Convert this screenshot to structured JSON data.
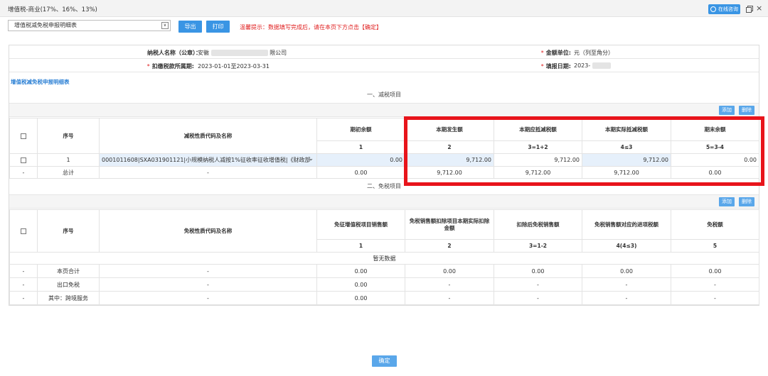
{
  "window": {
    "title": "增值税-商业(17%、16%、13%)",
    "online_consult": "在线咨询",
    "close_glyph": "×"
  },
  "toolbar": {
    "report_select": "增值税减免税申报明细表",
    "select_arrow": "∨",
    "export_label": "导出",
    "print_label": "打印",
    "tip": "温馨提示：数据填写完成后，请在本页下方点击【确定】"
  },
  "info": {
    "taxpayer_label": "纳税人名称（公章）：",
    "taxpayer_prefix": "安徽",
    "taxpayer_suffix": "限公司",
    "amount_unit_label": "金额单位:",
    "amount_unit_value": "元（列至角分）",
    "period_label": "扣缴税款所属期:",
    "period_value": "2023-01-01至2023-03-31",
    "fill_date_label": "填报日期:",
    "fill_date_value": "2023-",
    "star": "*"
  },
  "form_title": "增值税减免税申报明细表",
  "reduction": {
    "title": "一、减税项目",
    "add_label": "添加",
    "delete_label": "删除",
    "headers": {
      "seq": "序号",
      "name": "减税性质代码及名称",
      "c1": "期初余额",
      "c2": "本期发生额",
      "c3": "本期应抵减税额",
      "c4": "本期实际抵减税额",
      "c5": "期末余额"
    },
    "col_nums": [
      "1",
      "2",
      "3=1+2",
      "4≤3",
      "5=3-4"
    ],
    "row1": {
      "seq": "1",
      "name": "0001011608|SXA031901121|小规模纳税人减按1%征收率征收增值税|《财政部",
      "c1": "0.00",
      "c2": "9,712.00",
      "c3": "9,712.00",
      "c4": "9,712.00",
      "c5": "0.00"
    },
    "total": {
      "dash": "-",
      "label": "总计",
      "name": "-",
      "c1": "0.00",
      "c2": "9,712.00",
      "c3": "9,712.00",
      "c4": "9,712.00",
      "c5": "0.00"
    }
  },
  "exemption": {
    "title": "二、免税项目",
    "add_label": "添加",
    "delete_label": "删除",
    "headers": {
      "seq": "序号",
      "name": "免税性质代码及名称",
      "c1": "免征增值税项目销售额",
      "c2": "免税销售额扣除项目本期实际扣除金额",
      "c3": "扣除后免税销售额",
      "c4": "免税销售额对应的进项税额",
      "c5": "免税额"
    },
    "col_nums": [
      "1",
      "2",
      "3=1-2",
      "4(4≤3)",
      "5"
    ],
    "empty": "暂无数据",
    "rows": [
      {
        "dash": "-",
        "label": "本页合计",
        "name": "-",
        "c1": "0.00",
        "c2": "0.00",
        "c3": "0.00",
        "c4": "0.00",
        "c5": "0.00"
      },
      {
        "dash": "-",
        "label": "出口免税",
        "name": "-",
        "c1": "0.00",
        "c2": "-",
        "c3": "-",
        "c4": "-",
        "c5": "-"
      },
      {
        "dash": "-",
        "label": "其中：跨境服务",
        "name": "-",
        "c1": "0.00",
        "c2": "-",
        "c3": "-",
        "c4": "-",
        "c5": "-"
      }
    ]
  },
  "confirm_label": "确定",
  "colors": {
    "accent": "#3a95e4",
    "highlight_border": "#e8141b",
    "tip_text": "#e02020"
  }
}
